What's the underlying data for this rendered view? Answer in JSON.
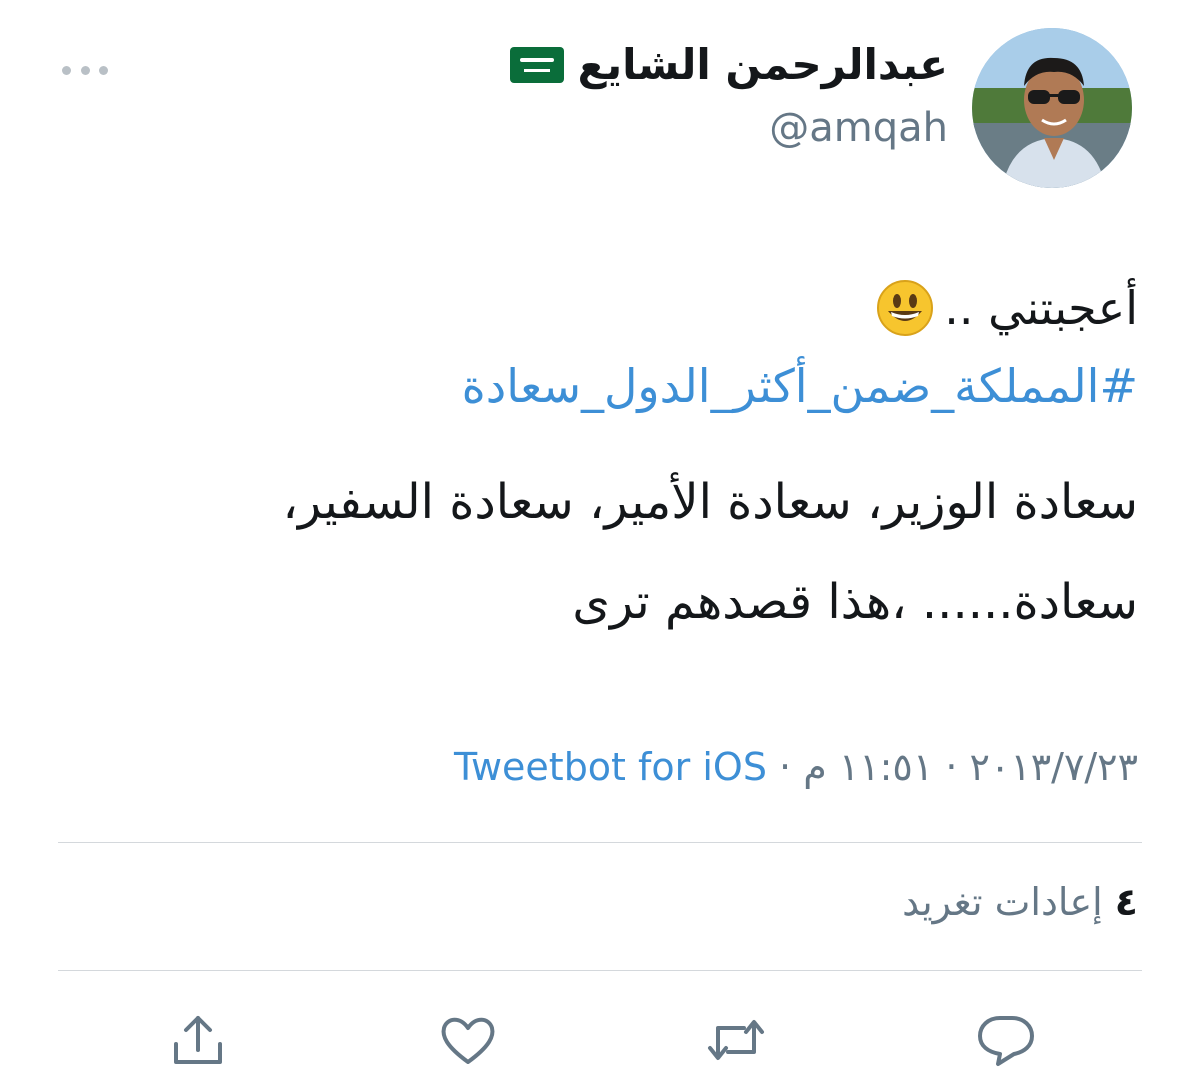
{
  "author": {
    "display_name": "عبدالرحمن الشايع",
    "handle": "@amqah",
    "flag": "saudi-arabia-flag"
  },
  "tweet": {
    "line1_text": "أعجبتني ..",
    "hashtag": "#المملكة_ضمن_أكثر_الدول_سعادة",
    "body_line1": "سعادة الوزير، سعادة الأمير، سعادة السفير،",
    "body_line2": "سعادة...... ،هذا قصدهم ترى"
  },
  "meta": {
    "date_time": "٢٠١٣/٧/٢٣ · ١١:٥١ م · ",
    "source": "Tweetbot for iOS"
  },
  "stats": {
    "retweet_count": "٤",
    "retweet_label": "إعادات تغريد"
  },
  "actions": [
    "reply-icon",
    "retweet-icon",
    "like-icon",
    "share-icon"
  ],
  "colors": {
    "link": "#3d8fd6",
    "secondary_text": "#657786",
    "primary_text": "#14171a"
  }
}
